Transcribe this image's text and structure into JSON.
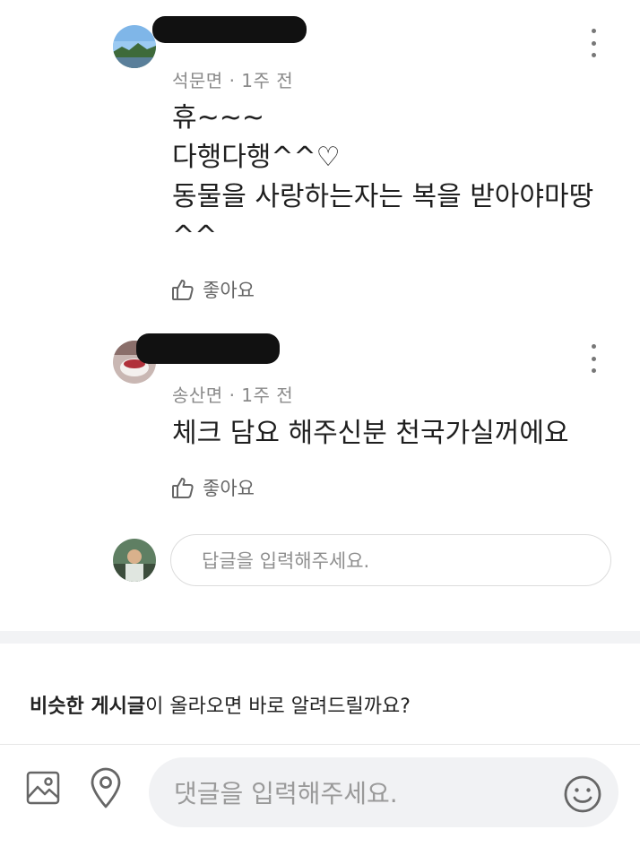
{
  "comments": [
    {
      "author": "",
      "location": "석문면",
      "time": "1주 전",
      "lines": [
        "휴~~~",
        "다행다행^^♡",
        "동물을 사랑하는자는 복을 받아야마땅",
        "^^"
      ],
      "like_label": "좋아요"
    },
    {
      "author": "",
      "location": "송산면",
      "time": "1주 전",
      "lines": [
        "체크 담요 해주신분 천국가실꺼에요"
      ],
      "like_label": "좋아요"
    }
  ],
  "meta_separator": "·",
  "reply_box": {
    "placeholder": "답글을 입력해주세요."
  },
  "similar_posts": {
    "bold": "비슷한 게시글",
    "rest": "이 올라오면 바로 알려드릴까요?"
  },
  "bottom_bar": {
    "placeholder": "댓글을 입력해주세요."
  },
  "icons": {
    "more": "kebab-icon",
    "like": "thumbs-up-icon",
    "image": "image-icon",
    "location": "location-pin-icon",
    "emoji": "smiley-icon"
  }
}
